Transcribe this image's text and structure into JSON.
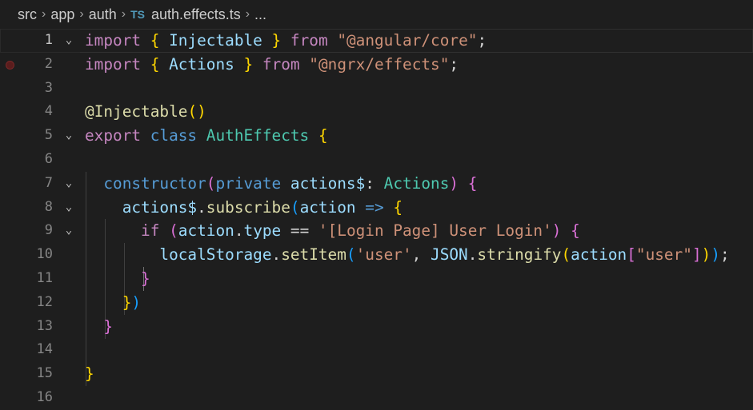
{
  "breadcrumb": {
    "items": [
      "src",
      "app",
      "auth"
    ],
    "file_badge": "TS",
    "file_name": "auth.effects.ts",
    "ellipsis": "..."
  },
  "editor": {
    "lines": [
      {
        "num": "1"
      },
      {
        "num": "2"
      },
      {
        "num": "3"
      },
      {
        "num": "4"
      },
      {
        "num": "5"
      },
      {
        "num": "6"
      },
      {
        "num": "7"
      },
      {
        "num": "8"
      },
      {
        "num": "9"
      },
      {
        "num": "10"
      },
      {
        "num": "11"
      },
      {
        "num": "12"
      },
      {
        "num": "13"
      },
      {
        "num": "14"
      },
      {
        "num": "15"
      },
      {
        "num": "16"
      }
    ],
    "tokens": {
      "l1": [
        "import",
        " ",
        "{",
        " ",
        "Injectable",
        " ",
        "}",
        " ",
        "from",
        " ",
        "\"@angular/core\"",
        ";"
      ],
      "l2": [
        "import",
        " ",
        "{",
        " ",
        "Actions",
        " ",
        "}",
        " ",
        "from",
        " ",
        "\"@ngrx/effects\"",
        ";"
      ],
      "l4": [
        "@",
        "Injectable",
        "(",
        ")"
      ],
      "l5": [
        "export",
        " ",
        "class",
        " ",
        "AuthEffects",
        " ",
        "{"
      ],
      "l7": [
        "  ",
        "constructor",
        "(",
        "private",
        " ",
        "actions$",
        ": ",
        "Actions",
        ")",
        " ",
        "{"
      ],
      "l8": [
        "    ",
        "actions$",
        ".",
        "subscribe",
        "(",
        "action",
        " ",
        "=>",
        " ",
        "{"
      ],
      "l9": [
        "      ",
        "if",
        " ",
        "(",
        "action",
        ".",
        "type",
        " == ",
        "'[Login Page] User Login'",
        ")",
        " ",
        "{"
      ],
      "l10": [
        "        ",
        "localStorage",
        ".",
        "setItem",
        "(",
        "'user'",
        ", ",
        "JSON",
        ".",
        "stringify",
        "(",
        "action",
        "[",
        "\"user\"",
        "]",
        ")",
        ")",
        ";"
      ],
      "l11": [
        "      ",
        "}"
      ],
      "l12": [
        "    ",
        "}",
        ")"
      ],
      "l13": [
        "  ",
        "}"
      ],
      "l15": [
        "}"
      ]
    }
  },
  "colors": {
    "background": "#1e1e1e",
    "keyword_control": "#c586c0",
    "keyword": "#569cd6",
    "identifier": "#9cdcfe",
    "type": "#4ec9b0",
    "function": "#dcdcaa",
    "string": "#ce9178",
    "bracket_1": "#ffd700",
    "bracket_2": "#da70d6",
    "bracket_3": "#179fff"
  },
  "icons": [
    "chevron-right-icon",
    "chevron-down-icon",
    "breakpoint-icon"
  ]
}
